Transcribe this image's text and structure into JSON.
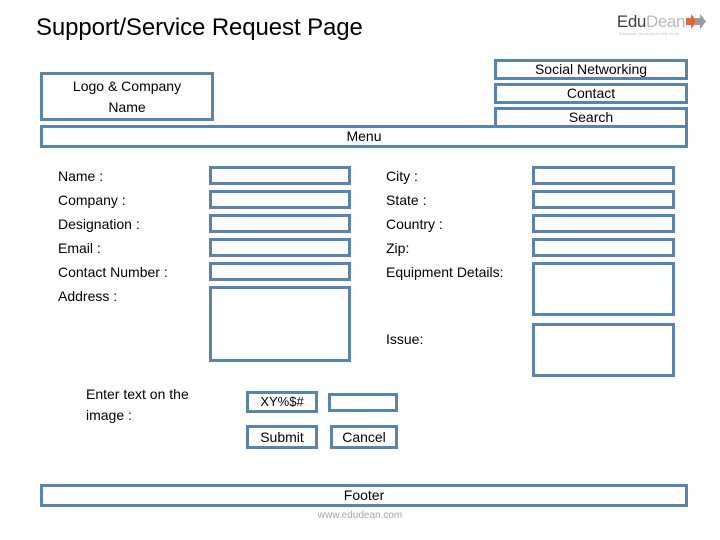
{
  "page": {
    "title": "Support/Service Request Page"
  },
  "brand": {
    "name_part1": "Edu",
    "name_part2": "Dean",
    "tagline": "Education Services on the Move",
    "mark_icon": "chevron-arrows-icon",
    "colors": {
      "part1": "#3f3f3f",
      "part2": "#b9b9b9",
      "mark_orange": "#e2663b",
      "mark_gray": "#9a9a9a"
    }
  },
  "header": {
    "logo_box": {
      "line1": "Logo & Company",
      "line2": "Name"
    },
    "nav": [
      {
        "label": "Social Networking"
      },
      {
        "label": "Contact"
      },
      {
        "label": "Search"
      }
    ],
    "menu_label": "Menu"
  },
  "form": {
    "left_fields": [
      {
        "label": "Name :",
        "value": "",
        "placeholder": ""
      },
      {
        "label": "Company :",
        "value": "",
        "placeholder": ""
      },
      {
        "label": "Designation :",
        "value": "",
        "placeholder": ""
      },
      {
        "label": "Email :",
        "value": "",
        "placeholder": ""
      },
      {
        "label": "Contact Number :",
        "value": "",
        "placeholder": ""
      },
      {
        "label": "Address :",
        "value": "",
        "placeholder": ""
      }
    ],
    "right_fields": [
      {
        "label": "City :",
        "value": "",
        "placeholder": ""
      },
      {
        "label": "State :",
        "value": "",
        "placeholder": ""
      },
      {
        "label": "Country :",
        "value": "",
        "placeholder": ""
      },
      {
        "label": "Zip:",
        "value": "",
        "placeholder": ""
      },
      {
        "label": "Equipment Details:",
        "value": "",
        "placeholder": ""
      },
      {
        "label": "Issue:",
        "value": "",
        "placeholder": ""
      }
    ]
  },
  "captcha": {
    "prompt": "Enter text on the image :",
    "challenge_text": "XY%$#",
    "input_value": "",
    "input_placeholder": ""
  },
  "actions": {
    "submit_label": "Submit",
    "cancel_label": "Cancel"
  },
  "footer": {
    "label": "Footer",
    "url": "www.edudean.com"
  },
  "theme": {
    "border_blue": "#5b83af",
    "text_black": "#000000",
    "muted_gray": "#a6a6a6",
    "page_background": "#ffffff"
  }
}
